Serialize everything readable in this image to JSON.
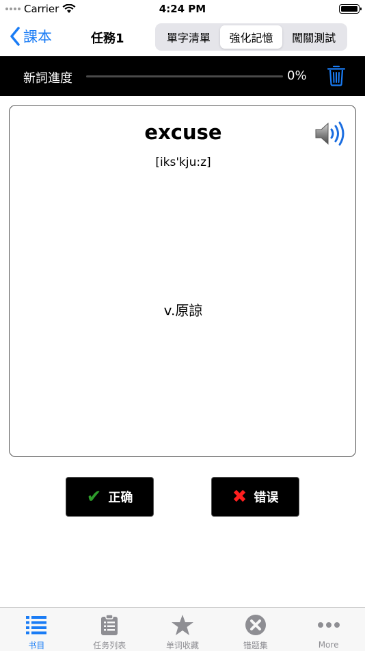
{
  "status_bar": {
    "carrier": "Carrier",
    "time": "4:24 PM"
  },
  "nav": {
    "back_label": "課本",
    "title": "任務1",
    "segments": [
      {
        "label": "單字清單",
        "active": false
      },
      {
        "label": "強化記憶",
        "active": true
      },
      {
        "label": "闖關測試",
        "active": false
      }
    ]
  },
  "progress": {
    "label": "新詞進度",
    "value_text": "0%",
    "value": 0
  },
  "card": {
    "word": "excuse",
    "phonetic": "[iks'kju:z]",
    "meaning": "v.原諒"
  },
  "answers": {
    "correct_label": "正确",
    "wrong_label": "错误"
  },
  "tabs": [
    {
      "label": "书目",
      "icon": "list-icon",
      "active": true
    },
    {
      "label": "任务列表",
      "icon": "clipboard-icon",
      "active": false
    },
    {
      "label": "单词收藏",
      "icon": "star-icon",
      "active": false
    },
    {
      "label": "错题集",
      "icon": "x-circle-icon",
      "active": false
    },
    {
      "label": "More",
      "icon": "more-icon",
      "active": false
    }
  ],
  "colors": {
    "accent": "#1a7cf5",
    "correct": "#2e9c2b",
    "wrong": "#ff1f1f",
    "tab_inactive": "#8e8e93"
  }
}
